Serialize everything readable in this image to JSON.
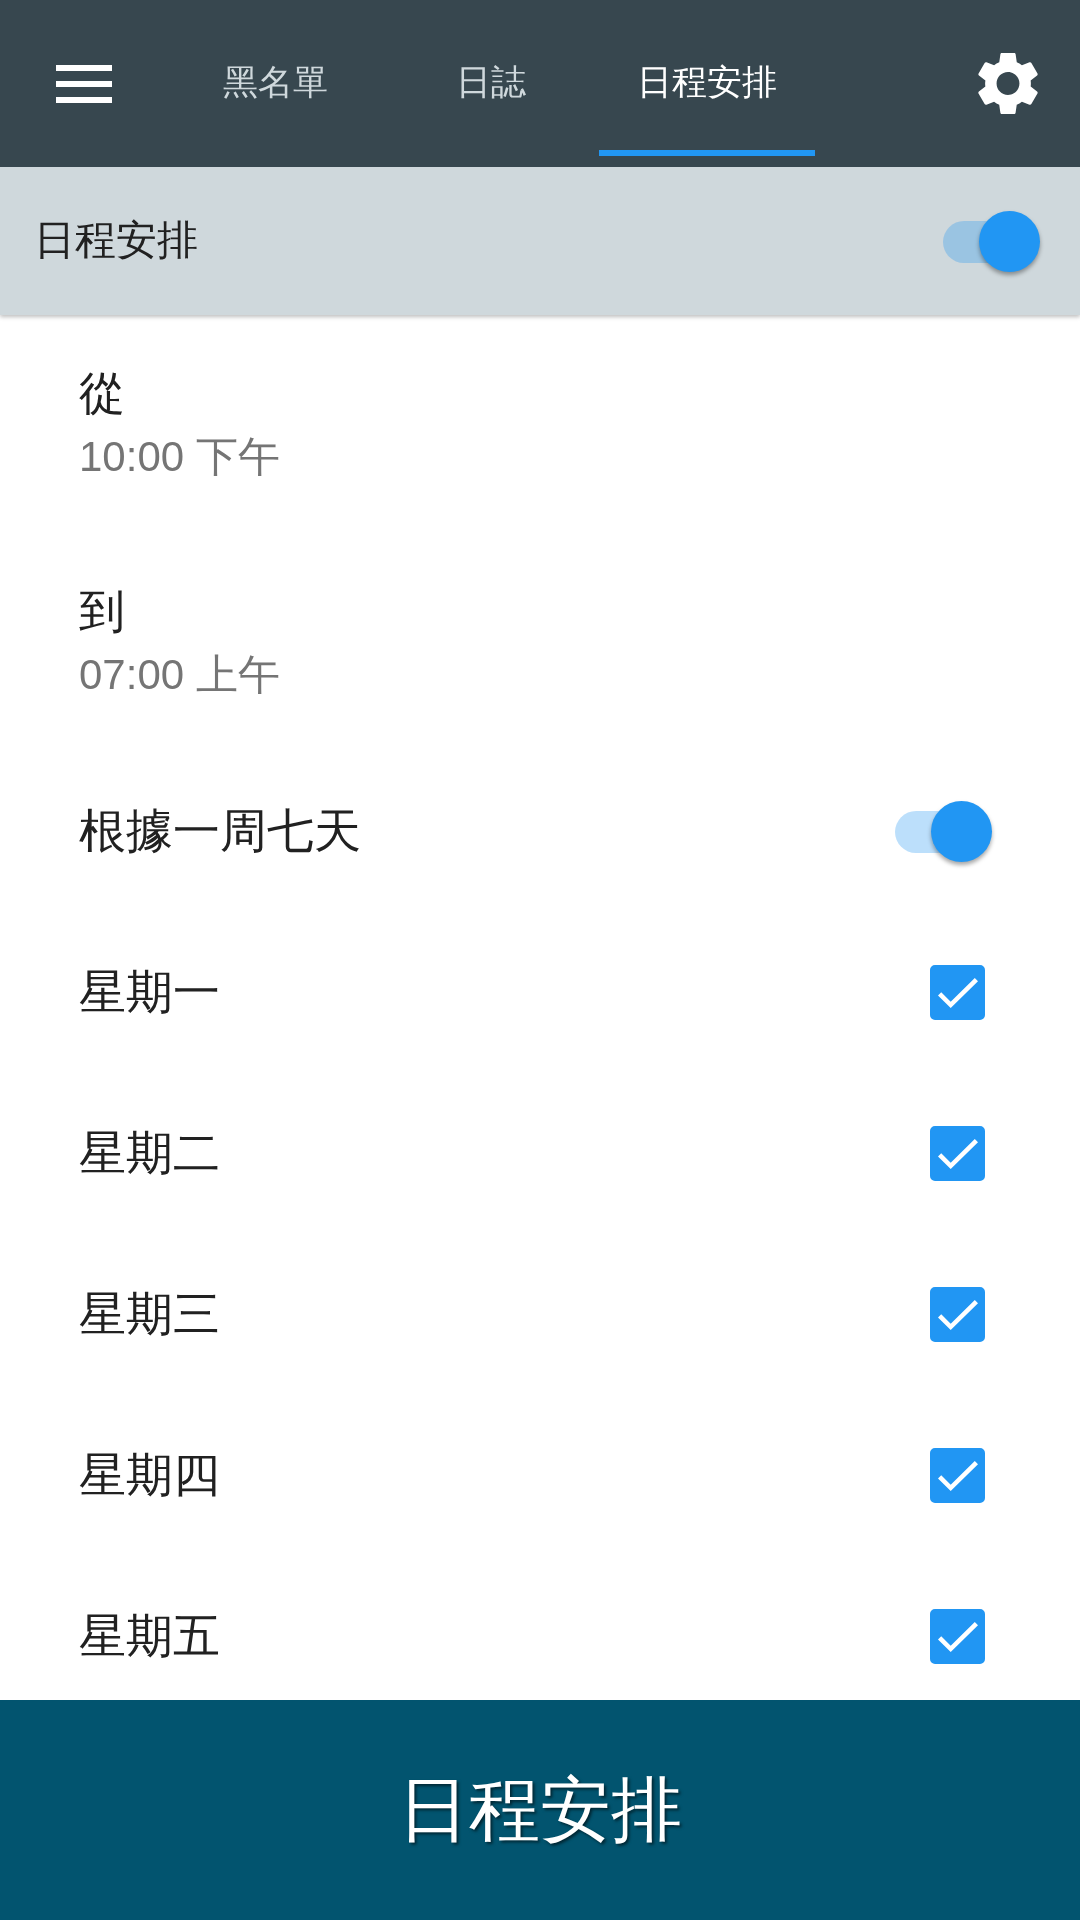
{
  "app_bar": {
    "tabs": [
      {
        "label": "黑名單",
        "selected": false
      },
      {
        "label": "日誌",
        "selected": false
      },
      {
        "label": "日程安排",
        "selected": true
      }
    ]
  },
  "schedule_header": {
    "title": "日程安排",
    "on": true
  },
  "time_range": [
    {
      "label": "從",
      "value": "10:00 下午"
    },
    {
      "label": "到",
      "value": "07:00 上午"
    }
  ],
  "weekdays_toggle": {
    "label": "根據一周七天",
    "on": true
  },
  "days": [
    {
      "label": "星期一",
      "checked": true
    },
    {
      "label": "星期二",
      "checked": true
    },
    {
      "label": "星期三",
      "checked": true
    },
    {
      "label": "星期四",
      "checked": true
    },
    {
      "label": "星期五",
      "checked": true
    }
  ],
  "bottom_button": {
    "label": "日程安排"
  }
}
